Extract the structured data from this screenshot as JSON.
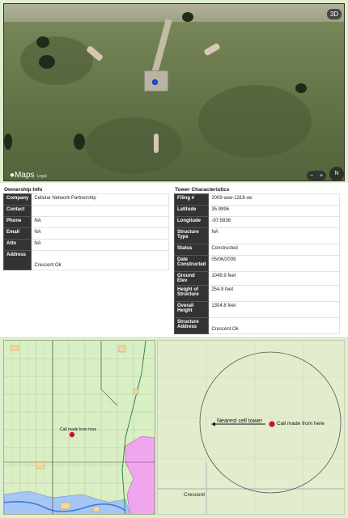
{
  "satellite": {
    "logo": "Maps",
    "legal": "Legal",
    "view_3d": "3D",
    "zoom_out": "−",
    "zoom_in": "+",
    "compass": "N"
  },
  "ownership": {
    "title": "Ownership Info",
    "rows": [
      {
        "key": "Company",
        "value": "Cellular Network Partnership"
      },
      {
        "key": "Contact",
        "value": ""
      },
      {
        "key": "Phone",
        "value": "NA"
      },
      {
        "key": "Email",
        "value": "NA"
      },
      {
        "key": "Attn",
        "value": "NA"
      },
      {
        "key": "Address",
        "value": "Crescent Ok"
      }
    ]
  },
  "tower": {
    "title": "Tower Characteristics",
    "rows": [
      {
        "key": "Filing #",
        "value": "2009-asw-1318-oe"
      },
      {
        "key": "Latitude",
        "value": "35.9996"
      },
      {
        "key": "Longitude",
        "value": "-97.5836"
      },
      {
        "key": "Structure Type",
        "value": "NA"
      },
      {
        "key": "Status",
        "value": "Constructed"
      },
      {
        "key": "Date Constructed",
        "value": "05/06/2009"
      },
      {
        "key": "Ground Elev",
        "value": "1049.9 feet"
      },
      {
        "key": "Height of Structure",
        "value": "254.9 feet"
      },
      {
        "key": "Overall Height",
        "value": "1304.8 feet"
      },
      {
        "key": "Structure Address",
        "value": "Crescent Ok"
      }
    ]
  },
  "coverage_map": {
    "call_label": "Call made from here"
  },
  "radius_map": {
    "tower_label": "Nearest cell tower",
    "call_label": "Call made from here",
    "town_label": "Crescent"
  },
  "colors": {
    "tower_marker": "#1455ff",
    "call_marker": "#c8102e",
    "table_key_bg": "#333333",
    "coverage_green": "#d8f0c4",
    "coverage_pink": "#f0a6ee",
    "coverage_blue": "#a7c6f5"
  }
}
